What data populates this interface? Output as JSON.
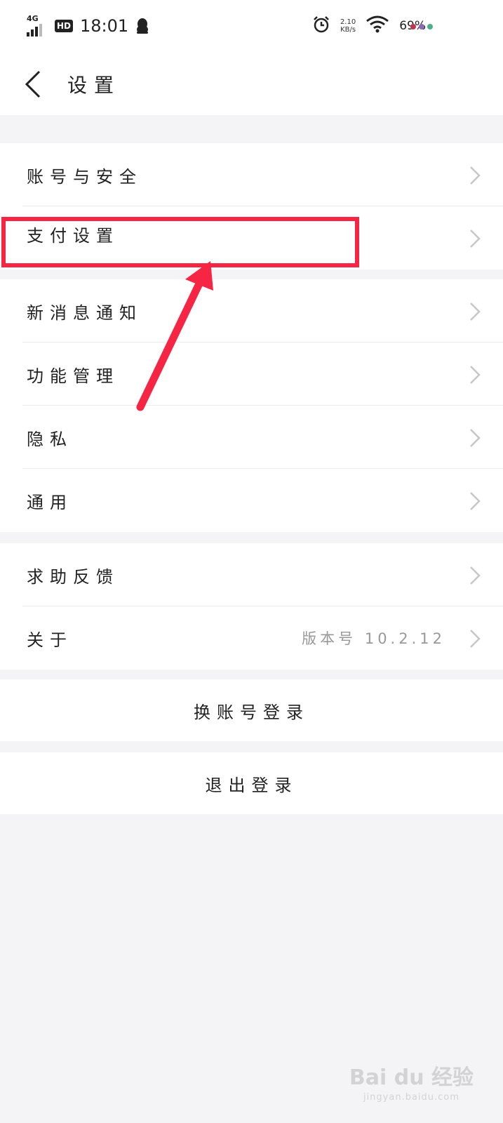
{
  "status_bar": {
    "network": "4G",
    "hd": "HD",
    "time": "18:01",
    "speed_value": "2.10",
    "speed_unit": "KB/s",
    "battery": "69%"
  },
  "header": {
    "title": "设置"
  },
  "menu": {
    "account_security": "账号与安全",
    "payment_settings": "支付设置",
    "new_message_notify": "新消息通知",
    "feature_manage": "功能管理",
    "privacy": "隐私",
    "general": "通用",
    "help_feedback": "求助反馈",
    "about": "关于",
    "about_version": "版本号 10.2.12"
  },
  "actions": {
    "switch_account": "换账号登录",
    "logout": "退出登录"
  },
  "watermark": {
    "main": "Bai du 经验",
    "sub": "jingyan.baidu.com"
  },
  "colors": {
    "annotation": "#f52543",
    "background": "#f4f3f6",
    "card": "#ffffff",
    "chevron": "#c7c7c7"
  },
  "icons": {
    "back": "chevron-left-icon",
    "row_arrow": "chevron-right-icon",
    "alarm": "alarm-icon",
    "wifi": "wifi-icon",
    "qq": "qq-penguin-icon"
  }
}
